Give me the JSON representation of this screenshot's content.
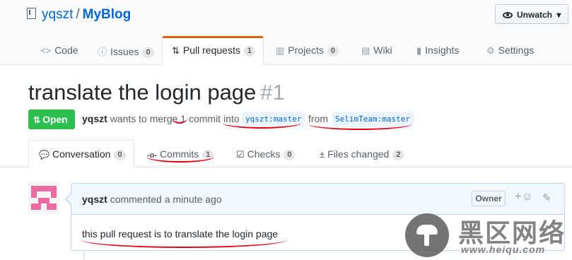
{
  "repo": {
    "owner": "yqszt",
    "separator": "/",
    "name": "MyBlog"
  },
  "watch_button": {
    "label": "Unwatch",
    "caret": "▾"
  },
  "nav_tabs": [
    {
      "label": "Code",
      "icon": "code-icon",
      "glyph": "<>"
    },
    {
      "label": "Issues",
      "count": "0",
      "icon": "issue-icon",
      "glyph": "ⓘ"
    },
    {
      "label": "Pull requests",
      "count": "1",
      "icon": "git-pull-request-icon",
      "glyph": "⇅",
      "active": true
    },
    {
      "label": "Projects",
      "count": "0",
      "icon": "project-icon",
      "glyph": "▥"
    },
    {
      "label": "Wiki",
      "icon": "book-icon",
      "glyph": "▤"
    },
    {
      "label": "Insights",
      "icon": "graph-icon",
      "glyph": "▮"
    },
    {
      "label": "Settings",
      "icon": "gear-icon",
      "glyph": "⚙"
    }
  ],
  "pull_request": {
    "title": "translate the login page",
    "number": "#1",
    "state": "Open",
    "author": "yqszt",
    "merge_text": "wants to merge 1 commit into",
    "base_branch": "yqszt:master",
    "from_text": "from",
    "head_branch": "SelimTeam:master"
  },
  "pr_tabs": [
    {
      "label": "Conversation",
      "count": "0",
      "icon": "comment-discussion-icon",
      "glyph": "💬"
    },
    {
      "label": "Commits",
      "count": "1",
      "icon": "git-commit-icon",
      "glyph": "-o-"
    },
    {
      "label": "Checks",
      "count": "0",
      "icon": "checklist-icon",
      "glyph": "☑"
    },
    {
      "label": "Files changed",
      "count": "2",
      "icon": "diff-icon",
      "glyph": "±"
    }
  ],
  "comment": {
    "author": "yqszt",
    "action": "commented a minute ago",
    "role_badge": "Owner",
    "body": "this pull request is to translate the login page",
    "react_glyph": "+☺",
    "edit_glyph": "✎"
  },
  "watermark": {
    "text": "黑区网络",
    "url": "www.heiqu.com"
  },
  "colors": {
    "accent": "#0366d6",
    "open_green": "#2cbe4e",
    "active_tab_border": "#e36209",
    "annotation_red": "#e60012"
  }
}
